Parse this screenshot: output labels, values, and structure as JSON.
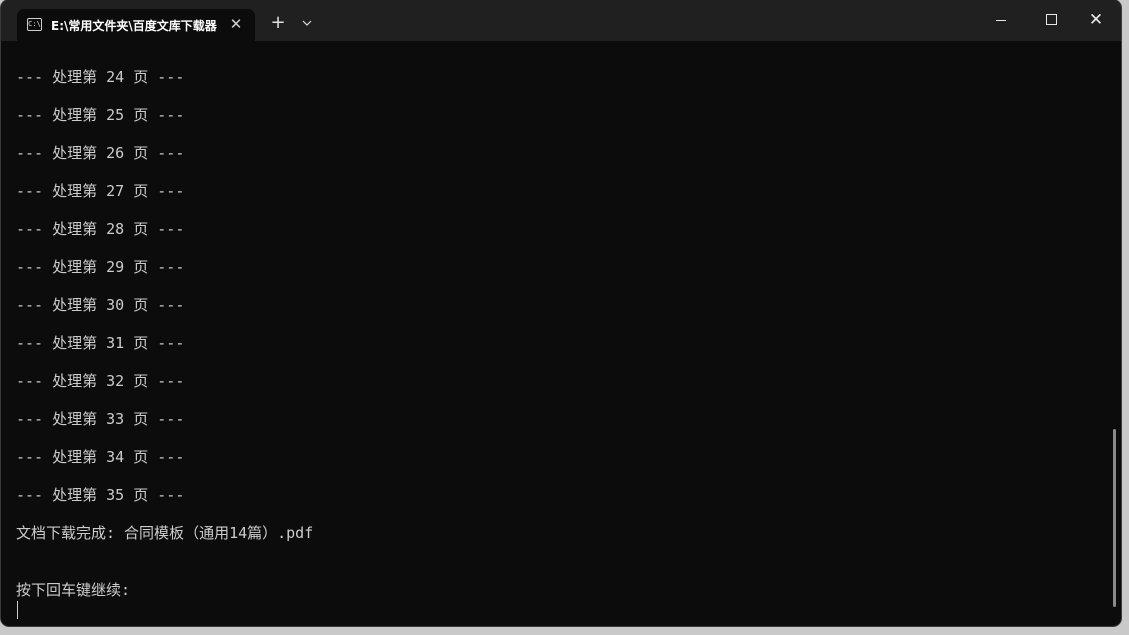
{
  "tab": {
    "title": "E:\\常用文件夹\\百度文库下载器",
    "icon": "terminal-icon",
    "close_glyph": "✕"
  },
  "toolbar": {
    "new_tab_glyph": "+",
    "dropdown_glyph": "⌵"
  },
  "window_controls": {
    "close_glyph": "✕"
  },
  "console": {
    "lines": [
      "--- 处理第 24 页 ---",
      "--- 处理第 25 页 ---",
      "--- 处理第 26 页 ---",
      "--- 处理第 27 页 ---",
      "--- 处理第 28 页 ---",
      "--- 处理第 29 页 ---",
      "--- 处理第 30 页 ---",
      "--- 处理第 31 页 ---",
      "--- 处理第 32 页 ---",
      "--- 处理第 33 页 ---",
      "--- 处理第 34 页 ---",
      "--- 处理第 35 页 ---",
      "文档下载完成: 合同模板（通用14篇）.pdf",
      "",
      "按下回车键继续:"
    ]
  },
  "colors": {
    "background": "#0c0c0c",
    "titlebar": "#202020",
    "text": "#cccccc"
  }
}
